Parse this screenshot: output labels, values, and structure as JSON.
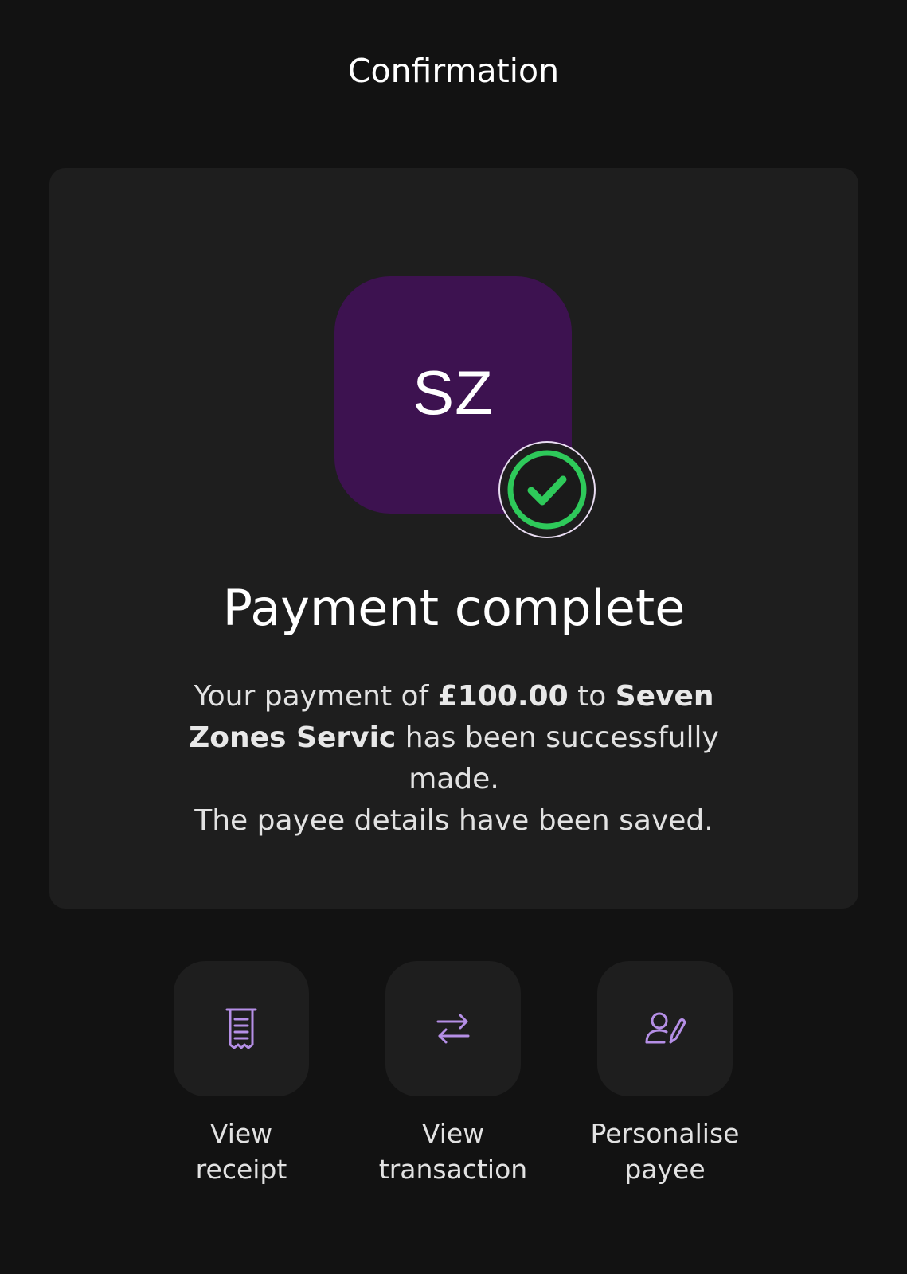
{
  "header": {
    "title": "Confirmation"
  },
  "colors": {
    "background": "#121212",
    "card": "#1e1e1e",
    "avatar": "#3d1250",
    "success_green": "#2ec95a",
    "icon_purple": "#b58fe6"
  },
  "payee": {
    "initials": "SZ",
    "status_icon": "check-circle-icon"
  },
  "confirmation": {
    "heading": "Payment complete",
    "message_prefix": "Your payment of ",
    "amount": "£100.00",
    "message_middle": " to ",
    "payee_name": "Seven Zones Servic",
    "message_suffix": " has been successfully made.",
    "note": "The payee details have been saved."
  },
  "actions": [
    {
      "icon": "receipt-icon",
      "label_line1": "View",
      "label_line2": "receipt"
    },
    {
      "icon": "transfer-arrows-icon",
      "label_line1": "View",
      "label_line2": "transaction"
    },
    {
      "icon": "person-edit-icon",
      "label_line1": "Personalise",
      "label_line2": "payee"
    }
  ]
}
